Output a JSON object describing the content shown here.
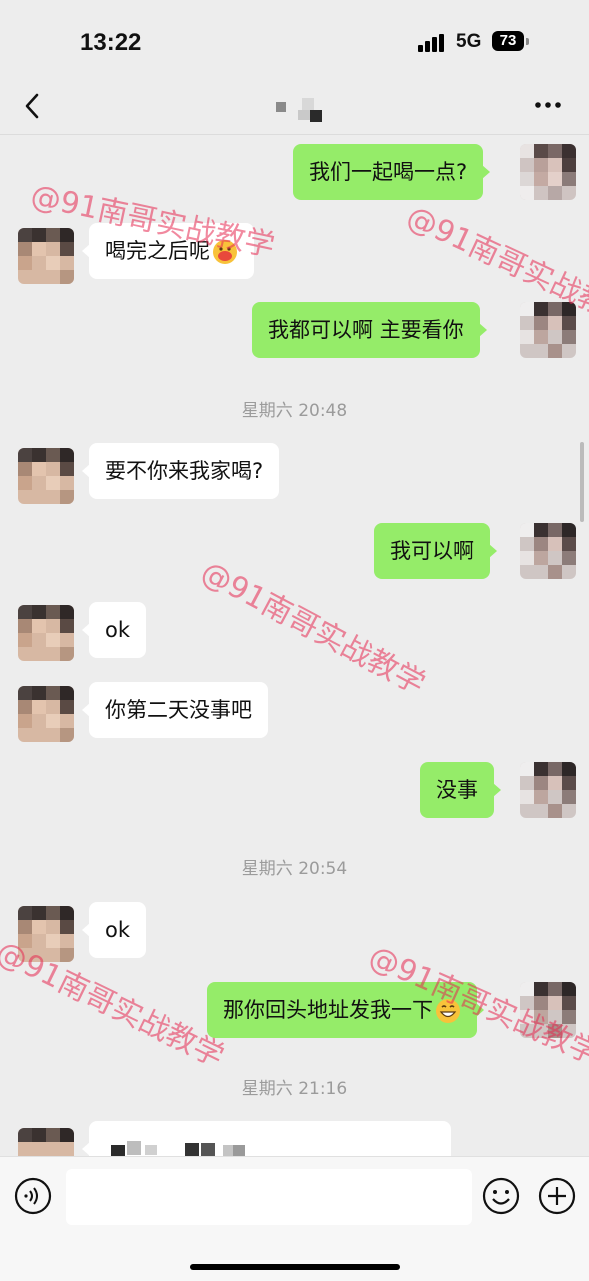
{
  "status_bar": {
    "time": "13:22",
    "network": "5G",
    "battery": "73"
  },
  "header": {
    "title": ""
  },
  "messages": [
    {
      "side": "out",
      "text": "我们一起喝一点?"
    },
    {
      "side": "in",
      "text": "喝完之后呢"
    },
    {
      "side": "out",
      "text": "我都可以啊 主要看你"
    },
    {
      "type": "time",
      "text": "星期六 20:48"
    },
    {
      "side": "in",
      "text": "要不你来我家喝?"
    },
    {
      "side": "out",
      "text": "我可以啊"
    },
    {
      "side": "in",
      "text": "ok"
    },
    {
      "side": "in",
      "text": "你第二天没事吧"
    },
    {
      "side": "out",
      "text": "没事"
    },
    {
      "type": "time",
      "text": "星期六 20:54"
    },
    {
      "side": "in",
      "text": "ok"
    },
    {
      "side": "out",
      "text": "那你回头地址发我一下"
    },
    {
      "type": "time",
      "text": "星期六 21:16"
    }
  ],
  "watermark": "@91南哥实战教学",
  "input": {
    "value": ""
  },
  "icons": {
    "back": "chevron-left-icon",
    "more": "more-horizontal-icon",
    "voice": "voice-icon",
    "emoji": "smile-icon",
    "plus": "plus-circle-icon"
  },
  "colors": {
    "outgoing_bubble": "#95ec69",
    "incoming_bubble": "#ffffff",
    "background": "#ededed",
    "watermark": "#e62850"
  }
}
